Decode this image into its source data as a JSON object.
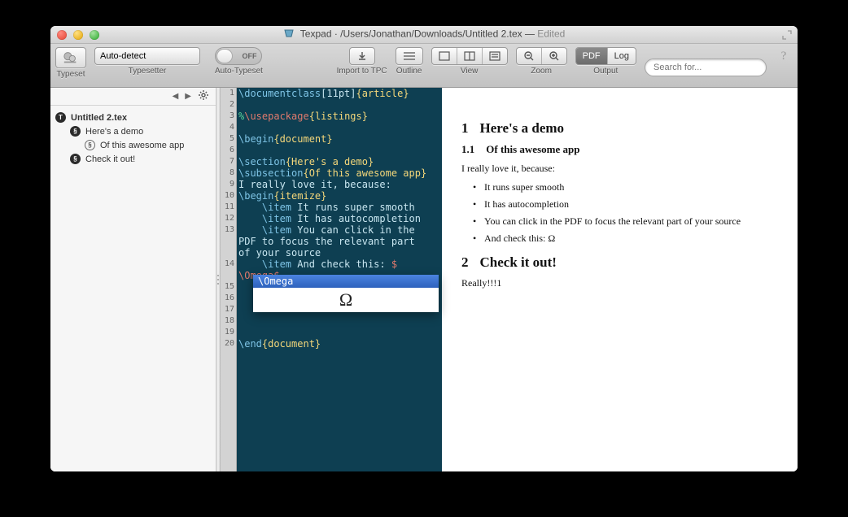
{
  "window": {
    "app": "Texpad",
    "path": "/Users/Jonathan/Downloads/Untitled 2.tex",
    "status": "Edited"
  },
  "toolbar": {
    "typeset_label": "Typeset",
    "typesetter_label": "Typesetter",
    "typesetter_value": "Auto-detect",
    "autotypeset_label": "Auto-Typeset",
    "autotypeset_state": "OFF",
    "import_label": "Import to TPC",
    "outline_label": "Outline",
    "view_label": "View",
    "zoom_label": "Zoom",
    "output_label": "Output",
    "output_pdf": "PDF",
    "output_log": "Log",
    "search_placeholder": "Search for..."
  },
  "outline": {
    "root": "Untitled 2.tex",
    "items": [
      {
        "level": "section",
        "label": "Here's a demo"
      },
      {
        "level": "subsection",
        "label": "Of this awesome app"
      },
      {
        "level": "section",
        "label": "Check it out!"
      }
    ]
  },
  "autocomplete": {
    "entry": "\\Omega",
    "preview_glyph": "Ω"
  },
  "source_lines": [
    {
      "n": 1,
      "segs": [
        [
          "cmd",
          "\\documentclass"
        ],
        [
          "opt",
          "[11pt]"
        ],
        [
          "brace",
          "{article}"
        ]
      ]
    },
    {
      "n": 2,
      "segs": []
    },
    {
      "n": 3,
      "segs": [
        [
          "comment",
          "%"
        ],
        [
          "und",
          "\\usepackage"
        ],
        [
          "brace",
          "{listings}"
        ]
      ]
    },
    {
      "n": 4,
      "segs": []
    },
    {
      "n": 5,
      "segs": [
        [
          "cmd",
          "\\begin"
        ],
        [
          "brace",
          "{document}"
        ]
      ]
    },
    {
      "n": 6,
      "segs": []
    },
    {
      "n": 7,
      "segs": [
        [
          "cmd",
          "\\section"
        ],
        [
          "brace",
          "{Here's a demo}"
        ]
      ]
    },
    {
      "n": 8,
      "segs": [
        [
          "cmd",
          "\\subsection"
        ],
        [
          "brace",
          "{Of this awesome app}"
        ]
      ]
    },
    {
      "n": 9,
      "segs": [
        [
          "opt",
          "I really love it, because:"
        ]
      ]
    },
    {
      "n": 10,
      "segs": [
        [
          "cmd",
          "\\begin"
        ],
        [
          "brace",
          "{itemize}"
        ]
      ]
    },
    {
      "n": 11,
      "segs": [
        [
          "opt",
          "    "
        ],
        [
          "cmd",
          "\\item"
        ],
        [
          "opt",
          " It runs super smooth"
        ]
      ]
    },
    {
      "n": 12,
      "segs": [
        [
          "opt",
          "    "
        ],
        [
          "cmd",
          "\\item"
        ],
        [
          "opt",
          " It has autocompletion"
        ]
      ]
    },
    {
      "n": 13,
      "segs": [
        [
          "opt",
          "    "
        ],
        [
          "cmd",
          "\\item"
        ],
        [
          "opt",
          " You can click in the"
        ]
      ]
    },
    {
      "n": null,
      "segs": [
        [
          "opt",
          "PDF to focus the relevant part"
        ]
      ]
    },
    {
      "n": null,
      "segs": [
        [
          "opt",
          "of your source"
        ]
      ]
    },
    {
      "n": 14,
      "segs": [
        [
          "opt",
          "    "
        ],
        [
          "cmd",
          "\\item"
        ],
        [
          "opt",
          " And check this: "
        ],
        [
          "math",
          "$"
        ]
      ]
    },
    {
      "n": null,
      "segs": [
        [
          "math",
          "\\Omega$"
        ]
      ]
    },
    {
      "n": 15,
      "segs": []
    },
    {
      "n": 16,
      "segs": []
    },
    {
      "n": 17,
      "segs": []
    },
    {
      "n": 18,
      "segs": []
    },
    {
      "n": 19,
      "segs": []
    },
    {
      "n": 20,
      "segs": [
        [
          "cmd",
          "\\end"
        ],
        [
          "brace",
          "{document}"
        ]
      ]
    }
  ],
  "preview": {
    "sec1_num": "1",
    "sec1_title": "Here's a demo",
    "sub1_num": "1.1",
    "sub1_title": "Of this awesome app",
    "intro": "I really love it, because:",
    "items": [
      "It runs super smooth",
      "It has autocompletion",
      "You can click in the PDF to focus the relevant part of your source",
      "And check this: Ω"
    ],
    "sec2_num": "2",
    "sec2_title": "Check it out!",
    "closing": "Really!!!1"
  }
}
